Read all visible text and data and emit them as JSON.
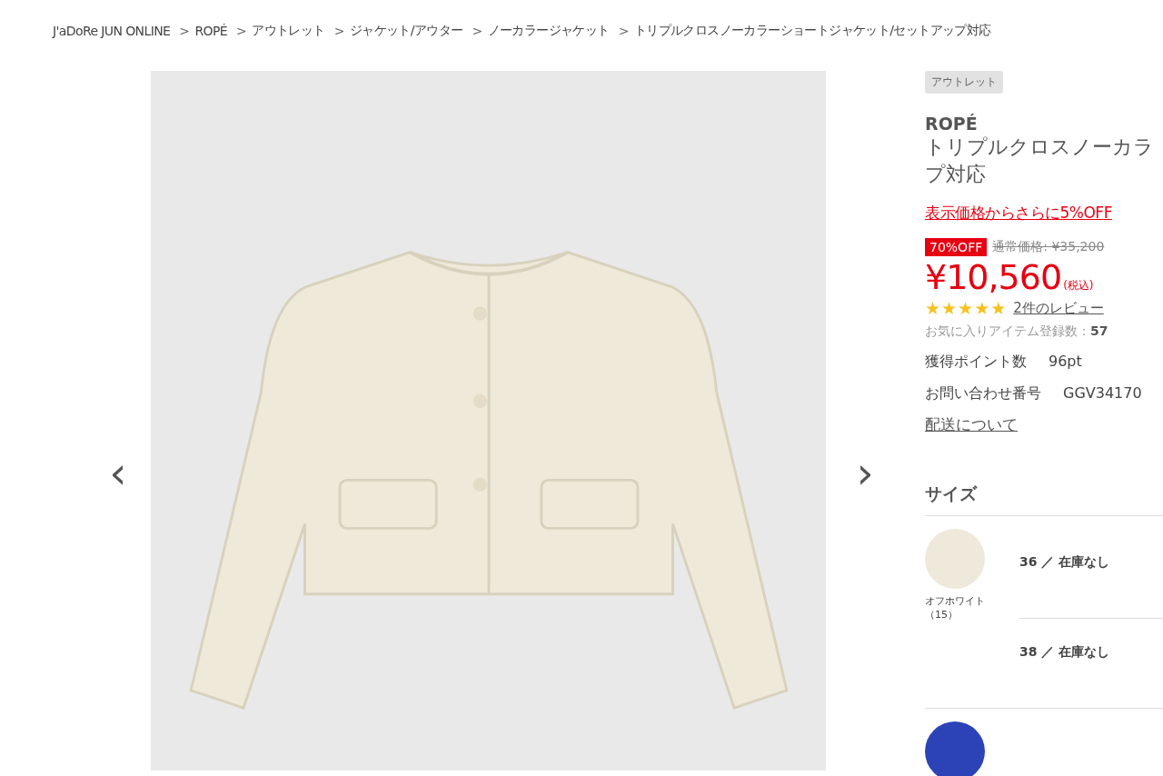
{
  "breadcrumb": [
    "J'aDoRe JUN ONLINE",
    "ROPÉ",
    "アウトレット",
    "ジャケット/アウター",
    "ノーカラージャケット",
    "トリプルクロスノーカラーショートジャケット/セットアップ対応"
  ],
  "breadcrumb_separator": ">",
  "gallery": {
    "prev": "‹",
    "next": "›"
  },
  "product": {
    "tag": "アウトレット",
    "brand": "ROPÉ",
    "title_lines": [
      "トリプルクロスノーカラ",
      "プ対応"
    ],
    "promo_link": "表示価格からさらに5%OFF",
    "discount_badge": "70%OFF",
    "regular_price": "通常価格: ¥35,200",
    "price": "¥10,560",
    "tax_note": "(税込)",
    "stars": 5,
    "review_link": "2件のレビュー",
    "favorites_label": "お気に入りアイテム登録数：",
    "favorites_count": "57",
    "specs": [
      {
        "label": "獲得ポイント数",
        "value": "96pt"
      },
      {
        "label": "お問い合わせ番号",
        "value": "GGV34170"
      }
    ],
    "shipping_link": "配送について"
  },
  "size_section": {
    "heading": "サイズ",
    "variants": [
      {
        "color": "#efe9dc",
        "label": "オフホワイト（15）",
        "sizes": [
          "36 ／ 在庫なし",
          "38 ／ 在庫なし"
        ]
      },
      {
        "color": "#2c43b8"
      }
    ]
  }
}
